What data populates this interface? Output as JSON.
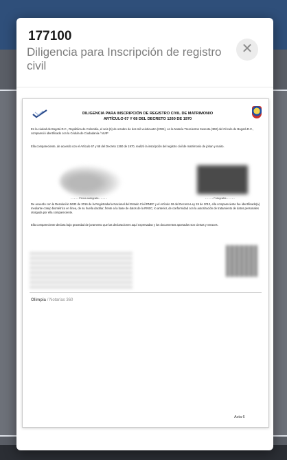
{
  "modal": {
    "code": "177100",
    "title": "Diligencia para Inscripción de registro civil",
    "close_glyph": "✕",
    "close_icon": "close-icon"
  },
  "document": {
    "title_line1": "DILIGENCIA PARA INSCRIPCIÓN DE REGISTRO CIVIL DE MATRIMONIO",
    "title_line2": "ARTÍCULO 67 Y 68 DEL DECRETO 1260 DE 1970",
    "para1": "En la ciudad de Bogotá D.C., República de Colombia, el seis (6) de octubre de dos mil veinticuatro (2024), en la Notaría Trescientos Sesenta (360) del Círculo de Bogotá D.C., compareció identificado con la Cédula de Ciudadanía / NUIP",
    "para2": "Ella compareciente, de acuerdo con el Artículo 67 y 68 del Decreto 1260 de 1970, realizó la inscripción del registro civil de matrimonio de johan y mairo.",
    "signature_caption": "- - - - - Firma autógrafa - - - - -",
    "photo_caption": "- - - - - Fotografía - - - - -",
    "para3": "De acuerdo con la Resolución 5633 de 2016 de la Registraduría Nacional del Estado Civil RNEC y el Artículo 18 del Decreto-Ley 19 de 2012, ella compareciente fue identificado(a) mediante cotejo biométrico en línea, de su huella dactilar, frente a la base de datos de la RNEC, lo anterior, de conformidad con la autorización de tratamiento de datos personales otorgada por ella compareciente.",
    "para4": "Ella compareciente declara bajo gravedad de juramento que las declaraciones aquí expresadas y los documentos aportados son ciertas y veraces.",
    "footer_brand": "Olimpia",
    "footer_text": "/ Notarías 360",
    "page_label": "Acta 6"
  }
}
